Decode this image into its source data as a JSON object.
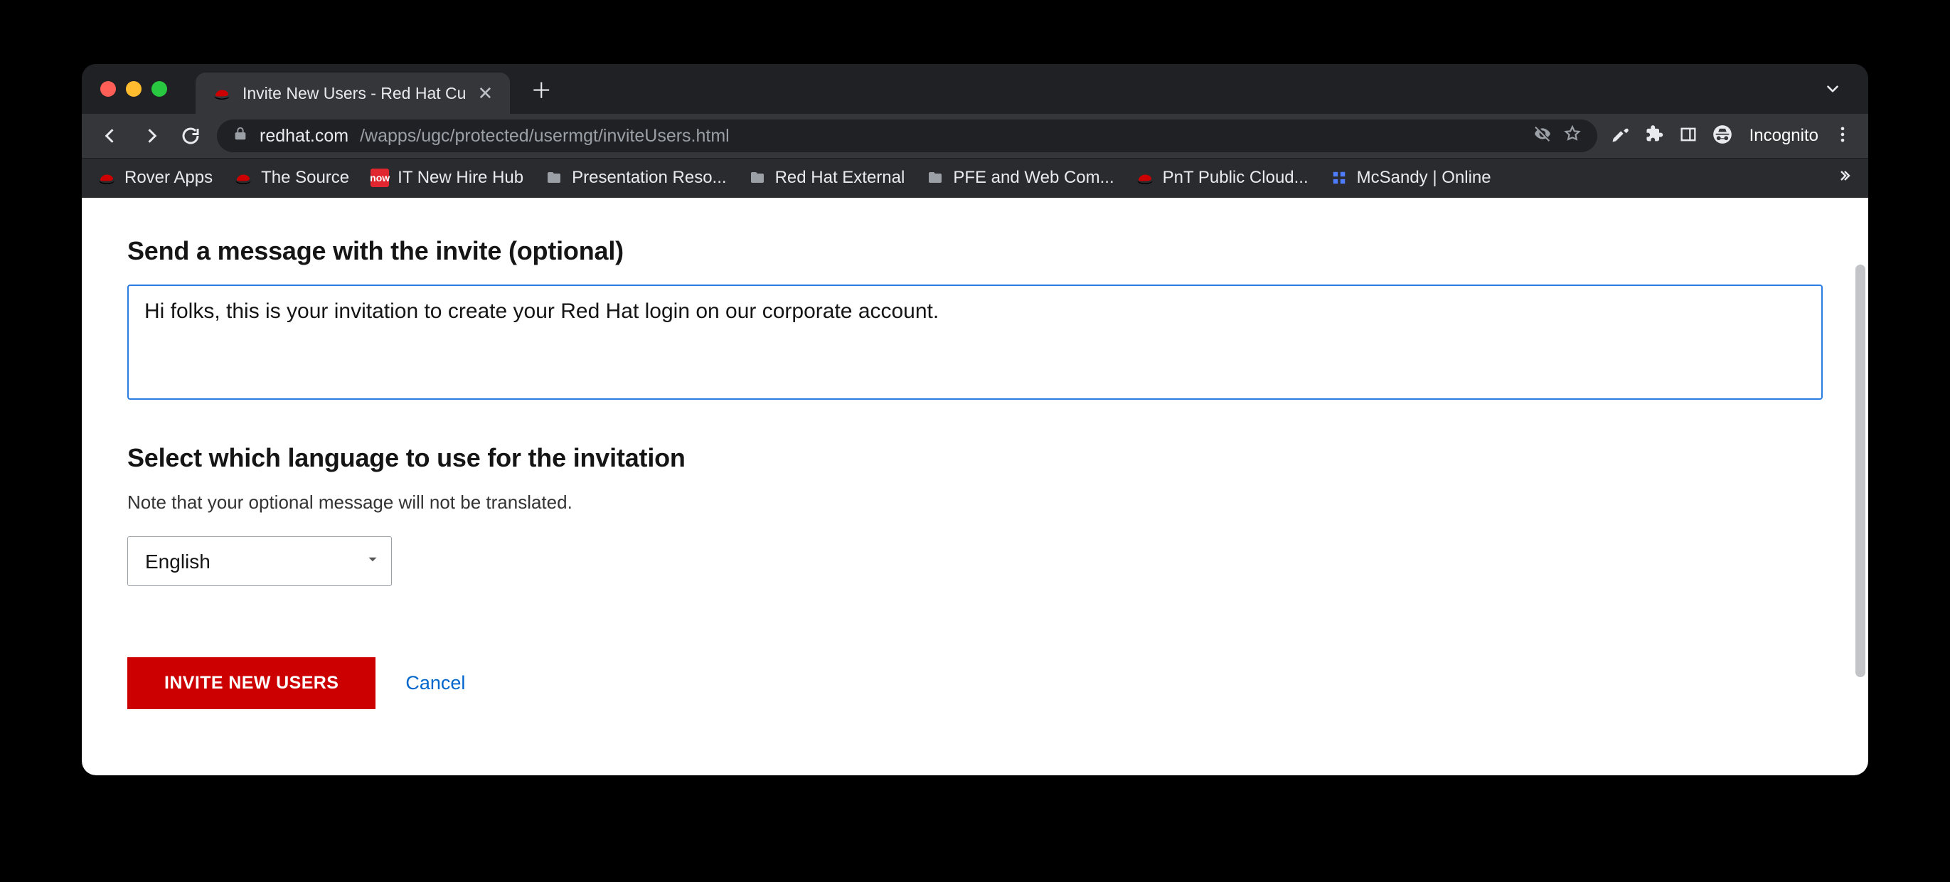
{
  "browser": {
    "tab_title": "Invite New Users - Red Hat Cu",
    "url_host": "redhat.com",
    "url_path": "/wapps/ugc/protected/usermgt/inviteUsers.html",
    "incognito_label": "Incognito",
    "now_badge": "now"
  },
  "bookmarks": [
    {
      "icon": "redhat",
      "label": "Rover Apps"
    },
    {
      "icon": "redhat",
      "label": "The Source"
    },
    {
      "icon": "now",
      "label": "IT New Hire Hub"
    },
    {
      "icon": "folder",
      "label": "Presentation Reso..."
    },
    {
      "icon": "folder",
      "label": "Red Hat External"
    },
    {
      "icon": "folder",
      "label": "PFE and Web Com..."
    },
    {
      "icon": "redhat",
      "label": "PnT Public Cloud..."
    },
    {
      "icon": "grid",
      "label": "McSandy | Online"
    }
  ],
  "form": {
    "message_section_title": "Send a message with the invite (optional)",
    "message_value": "Hi folks, this is your invitation to create your Red Hat login on our corporate account. ",
    "language_section_title": "Select which language to use for the invitation",
    "language_note": "Note that your optional message will not be translated.",
    "language_selected": "English",
    "submit_label": "INVITE NEW USERS",
    "cancel_label": "Cancel"
  }
}
